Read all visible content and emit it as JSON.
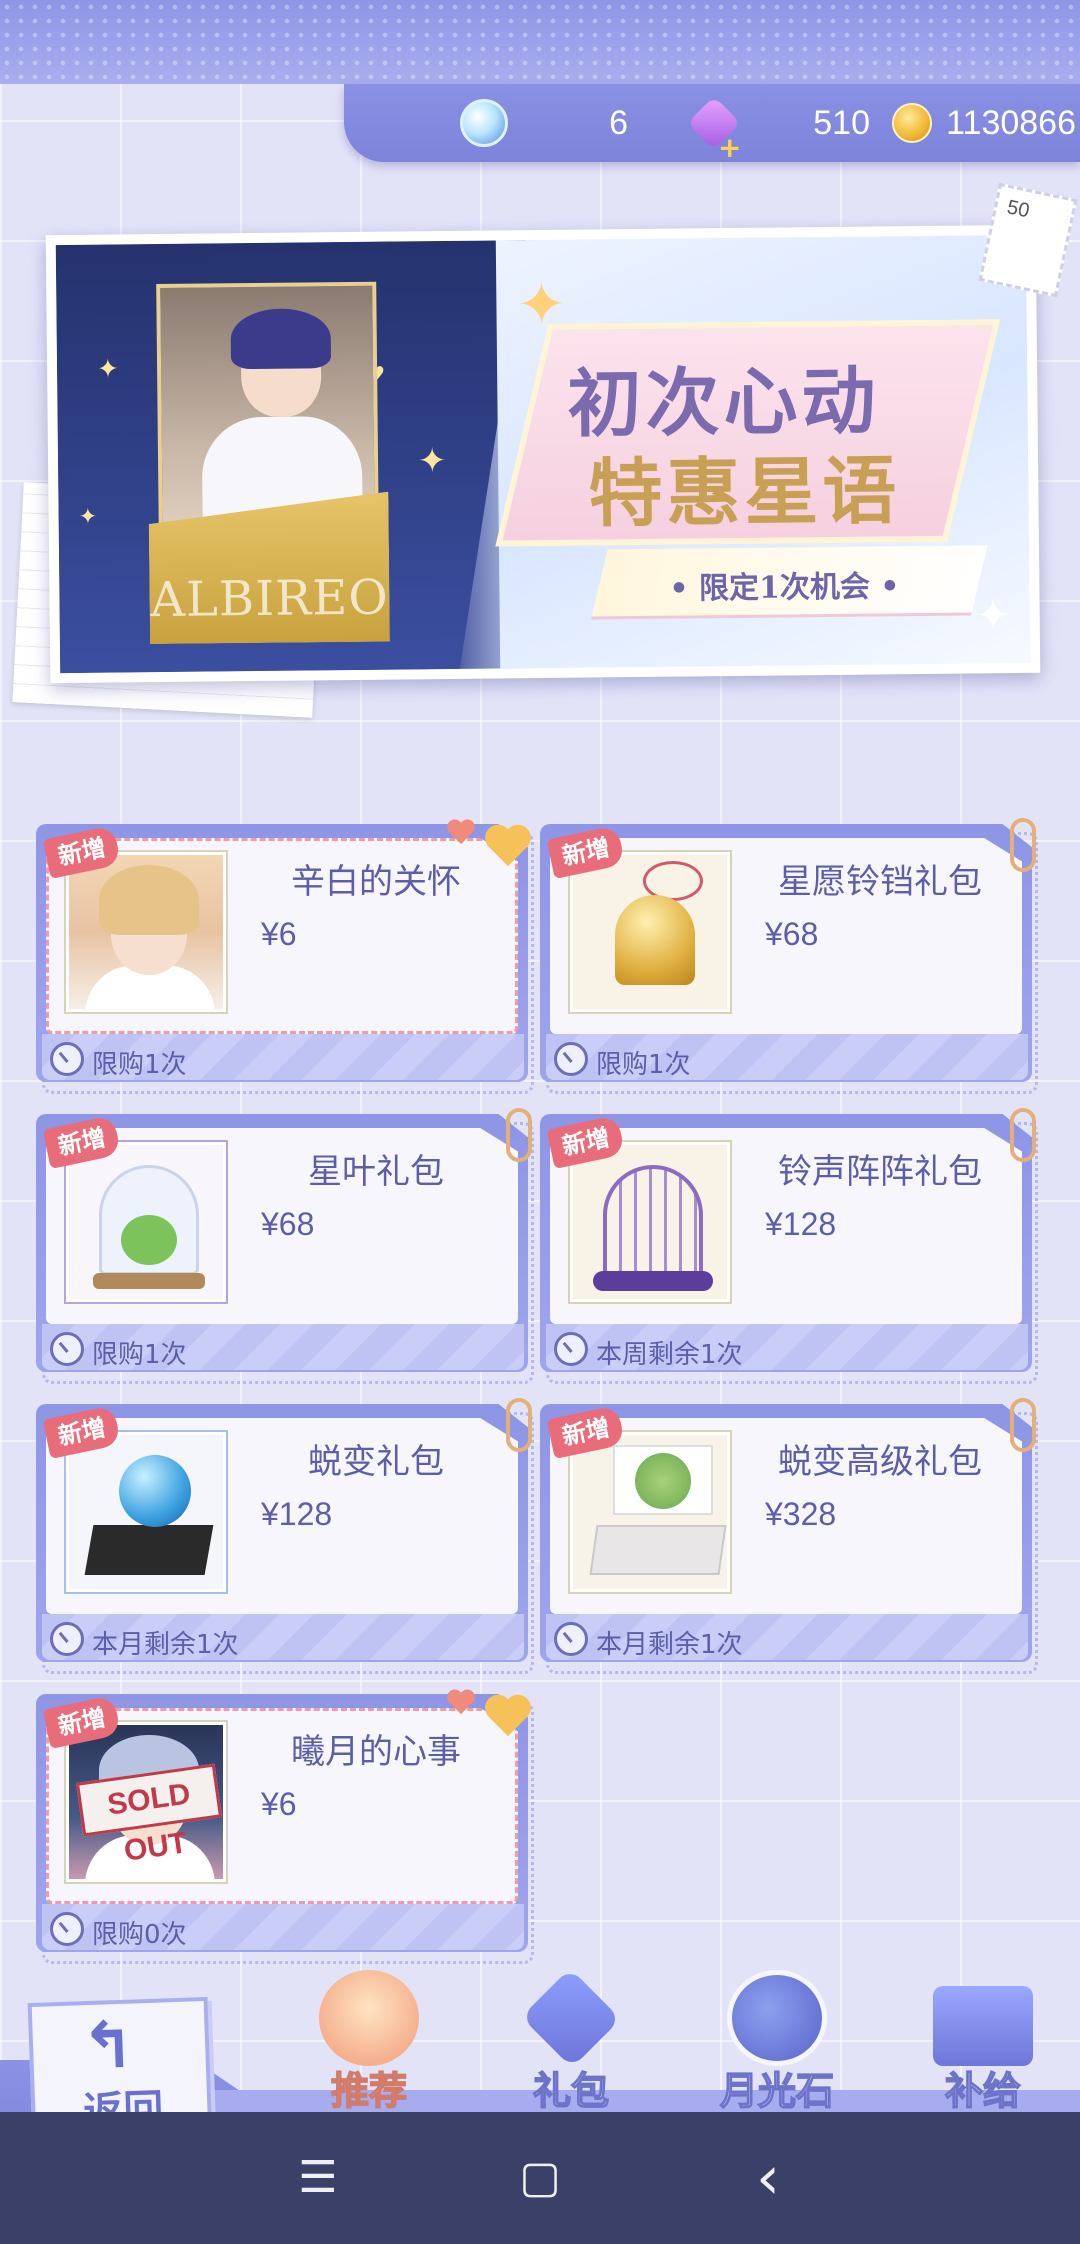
{
  "currency": {
    "gems": "6",
    "crystals": "510",
    "coins": "1130866"
  },
  "banner": {
    "title_line1": "初次心动",
    "title_line2": "特惠星语",
    "subtitle": "• 限定1次机会 •",
    "card_text": "ALBIREO",
    "stamp_number": "50"
  },
  "badge_new": "新增",
  "packs": [
    {
      "name": "辛白的关怀",
      "price": "¥6",
      "limit": "限购1次"
    },
    {
      "name": "星愿铃铛礼包",
      "price": "¥68",
      "limit": "限购1次"
    },
    {
      "name": "星叶礼包",
      "price": "¥68",
      "limit": "限购1次"
    },
    {
      "name": "铃声阵阵礼包",
      "price": "¥128",
      "limit": "本周剩余1次"
    },
    {
      "name": "蜕变礼包",
      "price": "¥128",
      "limit": "本月剩余1次"
    },
    {
      "name": "蜕变高级礼包",
      "price": "¥328",
      "limit": "本月剩余1次"
    },
    {
      "name": "曦月的心事",
      "price": "¥6",
      "limit": "限购0次",
      "sold_out_label": "SOLD OUT"
    }
  ],
  "nav": {
    "back": "返回",
    "tabs": [
      {
        "label": "推荐",
        "active": true
      },
      {
        "label": "礼包",
        "active": false
      },
      {
        "label": "月光石",
        "active": false
      },
      {
        "label": "补给",
        "active": false
      }
    ]
  },
  "system_nav": {
    "menu": "☰",
    "home": "▢",
    "back": "‹"
  }
}
